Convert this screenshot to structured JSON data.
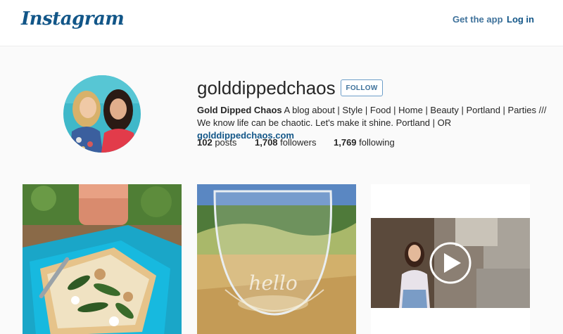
{
  "header": {
    "logo_text": "Instagram",
    "get_app_label": "Get the app",
    "login_label": "Log in"
  },
  "profile": {
    "username": "golddippedchaos",
    "follow_label": "FOLLOW",
    "bio": {
      "name": "Gold Dipped Chaos",
      "text": "A blog about | Style | Food | Home | Beauty | Portland | Parties /// We know life can be chaotic. Let's make it shine. Portland | OR",
      "link": "golddippedchaos.com"
    },
    "stats": {
      "posts_count": "102",
      "posts_label": "posts",
      "followers_count": "1,708",
      "followers_label": "followers",
      "following_count": "1,769",
      "following_label": "following"
    }
  },
  "posts": [
    {
      "type": "image",
      "icon": "pizza-photo"
    },
    {
      "type": "image",
      "icon": "wine-glass-photo"
    },
    {
      "type": "video",
      "icon": "play-icon"
    }
  ],
  "colors": {
    "brand": "#125688",
    "link": "#3f729b",
    "follow_border": "#6d9ec9",
    "background": "#fafafa"
  }
}
